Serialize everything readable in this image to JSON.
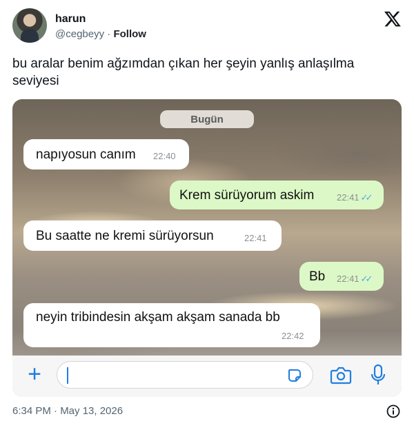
{
  "tweet": {
    "author_name": "harun",
    "handle": "@cegbeyy",
    "separator": "·",
    "follow_label": "Follow",
    "text": "bu aralar benim ağzımdan çıkan her şeyin yanlış anlaşılma seviyesi",
    "timestamp": "6:34 PM · May 13, 2026",
    "icons": {
      "logo": "x-logo-icon",
      "info": "info-icon"
    }
  },
  "chat": {
    "day_label": "Bugün",
    "messages": [
      {
        "direction": "incoming",
        "text": "napıyosun canım",
        "time": "22:40"
      },
      {
        "direction": "outgoing",
        "text": "Krem sürüyorum askim",
        "time": "22:41",
        "ticks": "✓✓"
      },
      {
        "direction": "incoming",
        "text": "Bu saatte ne kremi sürüyorsun",
        "time": "22:41"
      },
      {
        "direction": "outgoing",
        "text": "Bb",
        "time": "22:41",
        "ticks": "✓✓"
      },
      {
        "direction": "incoming",
        "text": "neyin tribindesin akşam akşam sanada bb",
        "time": "22:42"
      }
    ],
    "composer": {
      "plus": "+",
      "input_value": "",
      "icons": [
        "plus-icon",
        "sticker-icon",
        "camera-icon",
        "microphone-icon"
      ]
    },
    "colors": {
      "incoming": "#ffffff",
      "outgoing": "#dcf8c6",
      "accent": "#1f7ee0",
      "read_ticks": "#4fa8e6"
    }
  }
}
